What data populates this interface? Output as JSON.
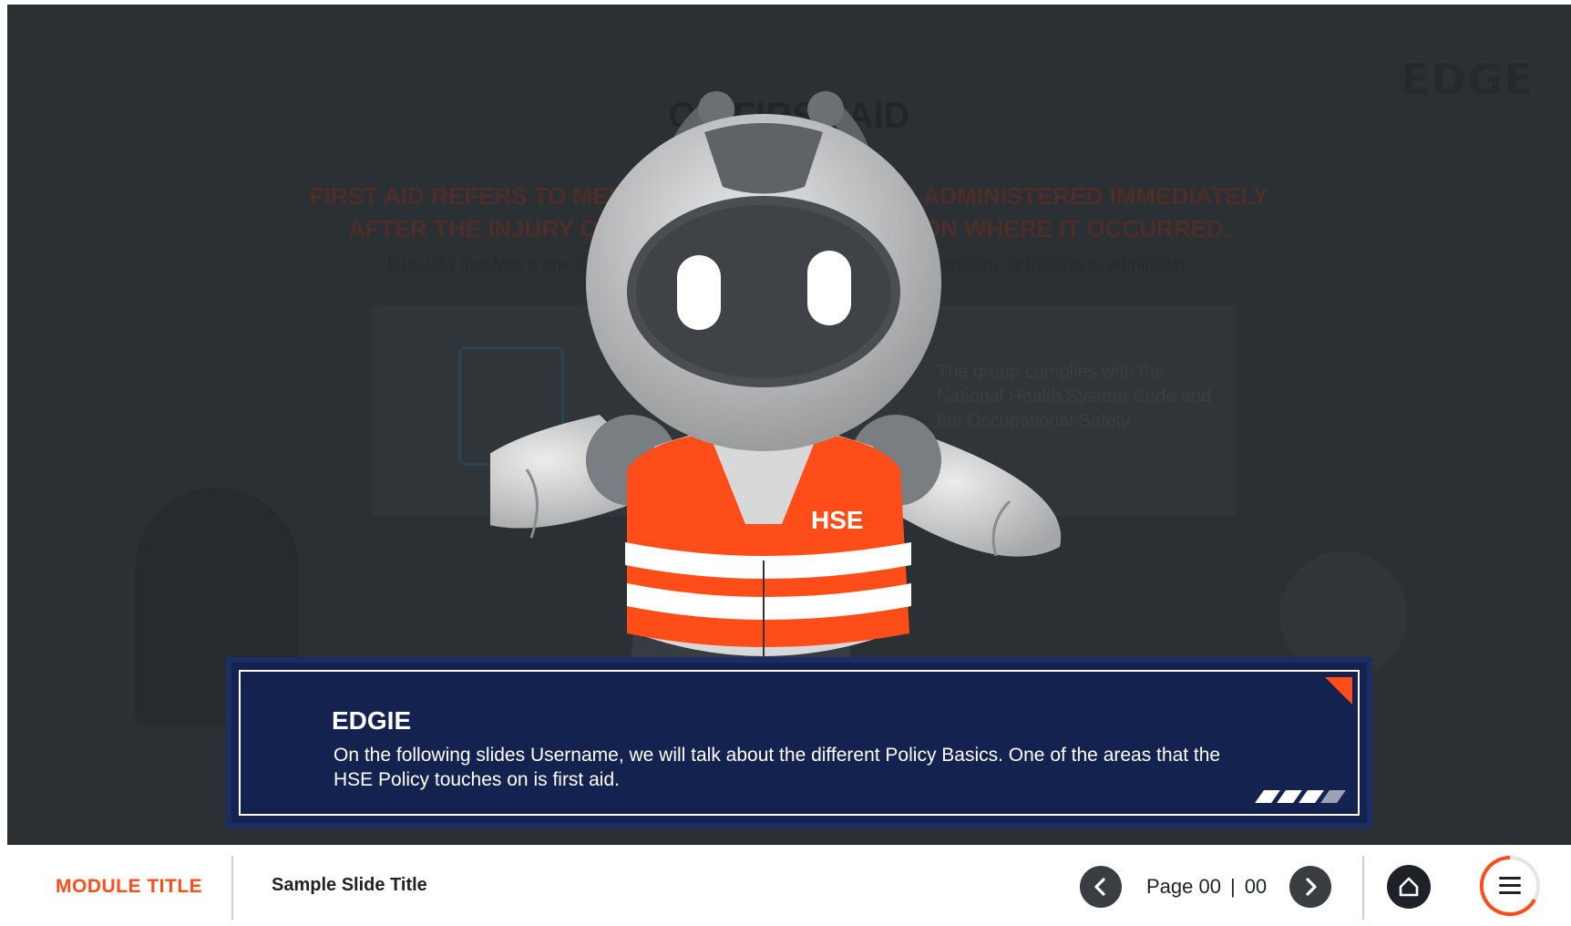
{
  "background": {
    "logo_text": "EDGE",
    "title": "ON FIRST AID",
    "headline": "FIRST AID REFERS TO MEDICAL ATTENTION THAT IS ADMINISTERED IMMEDIATELY AFTER THE INJURY OCCURS AND AT THE LOCATION WHERE IT OCCURRED.",
    "subtext": "It usually involves a one-time, short-term treatment and requires little technology or training to administer.",
    "card_text": "The group complies with the National Health System Code and the Occupational Safety"
  },
  "character": {
    "vest_label": "HSE"
  },
  "dialog": {
    "speaker": "EDGIE",
    "message": "On the following slides Username, we will talk about the different Policy Basics. One of the areas that the HSE Policy touches on is first aid."
  },
  "footer": {
    "module_title": "MODULE TITLE",
    "slide_title": "Sample Slide Title",
    "page_label": "Page 00",
    "page_separator": "|",
    "page_total": "00"
  },
  "icons": {
    "prev": "chevron-left-icon",
    "next": "chevron-right-icon",
    "home": "home-icon",
    "menu": "hamburger-menu-icon"
  },
  "colors": {
    "accent": "#ff4d1a",
    "dialog_bg": "#14224f",
    "slide_bg": "#2b3034",
    "nav_button": "#3a3d42"
  }
}
